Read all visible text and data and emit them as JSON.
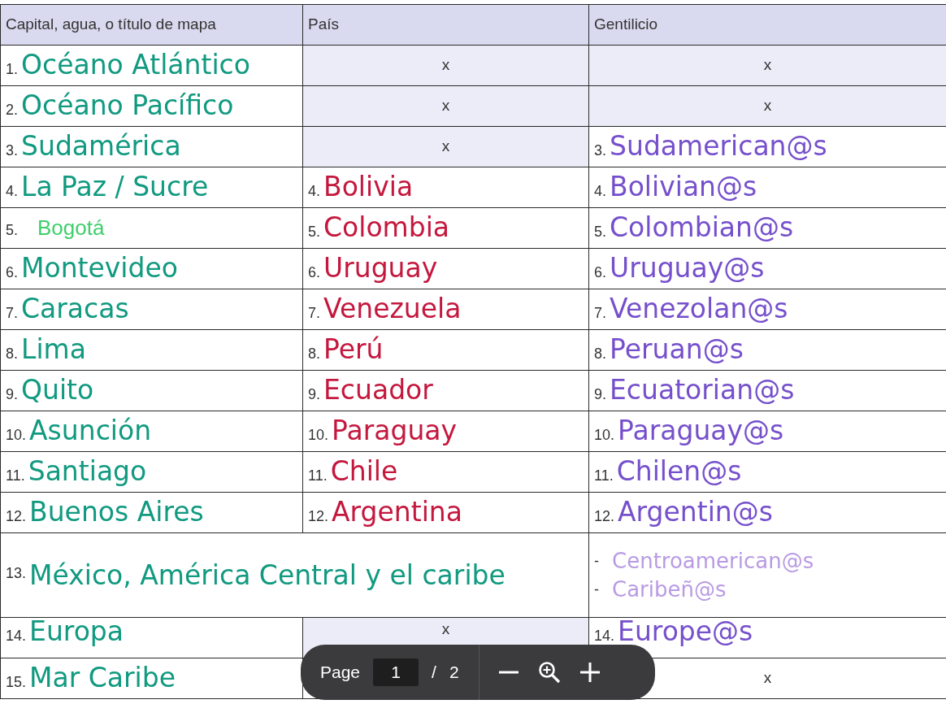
{
  "table": {
    "columns": [
      "Capital, agua, o título de mapa",
      "País",
      "Gentilicio"
    ],
    "rows": [
      {
        "cells": [
          {
            "kind": "handwritten",
            "number": "1.",
            "text": "Océano Atlántico",
            "shaded": false
          },
          {
            "kind": "mark",
            "text": "x",
            "shaded": true
          },
          {
            "kind": "mark",
            "text": "x",
            "shaded": true
          }
        ]
      },
      {
        "cells": [
          {
            "kind": "handwritten",
            "number": "2.",
            "text": "Océano Pacífico",
            "shaded": false
          },
          {
            "kind": "mark",
            "text": "x",
            "shaded": true
          },
          {
            "kind": "mark",
            "text": "x",
            "shaded": true
          }
        ]
      },
      {
        "cells": [
          {
            "kind": "handwritten",
            "number": "3.",
            "text": "Sudamérica",
            "shaded": false
          },
          {
            "kind": "mark",
            "text": "x",
            "shaded": true
          },
          {
            "kind": "handwritten",
            "number": "3.",
            "text": "Sudamerican@s",
            "shaded": false
          }
        ]
      },
      {
        "cells": [
          {
            "kind": "handwritten",
            "number": "4.",
            "text": "La Paz / Sucre",
            "shaded": false
          },
          {
            "kind": "handwritten",
            "number": "4.",
            "text": "Bolivia",
            "shaded": false
          },
          {
            "kind": "handwritten",
            "number": "4.",
            "text": "Bolivian@s",
            "shaded": false
          }
        ]
      },
      {
        "cells": [
          {
            "kind": "typed",
            "number": "5.",
            "text": "Bogotá",
            "shaded": false
          },
          {
            "kind": "handwritten",
            "number": "5.",
            "text": "Colombia",
            "shaded": false
          },
          {
            "kind": "handwritten",
            "number": "5.",
            "text": "Colombian@s",
            "shaded": false
          }
        ]
      },
      {
        "cells": [
          {
            "kind": "handwritten",
            "number": "6.",
            "text": "Montevideo",
            "shaded": false
          },
          {
            "kind": "handwritten",
            "number": "6.",
            "text": "Uruguay",
            "shaded": false
          },
          {
            "kind": "handwritten",
            "number": "6.",
            "text": "Uruguay@s",
            "shaded": false
          }
        ]
      },
      {
        "cells": [
          {
            "kind": "handwritten",
            "number": "7.",
            "text": "Caracas",
            "shaded": false
          },
          {
            "kind": "handwritten",
            "number": "7.",
            "text": "Venezuela",
            "shaded": false
          },
          {
            "kind": "handwritten",
            "number": "7.",
            "text": "Venezolan@s",
            "shaded": false
          }
        ]
      },
      {
        "cells": [
          {
            "kind": "handwritten",
            "number": "8.",
            "text": "Lima",
            "shaded": false
          },
          {
            "kind": "handwritten",
            "number": "8.",
            "text": "Perú",
            "shaded": false
          },
          {
            "kind": "handwritten",
            "number": "8.",
            "text": "Peruan@s",
            "shaded": false
          }
        ]
      },
      {
        "cells": [
          {
            "kind": "handwritten",
            "number": "9.",
            "text": "Quito",
            "shaded": false
          },
          {
            "kind": "handwritten",
            "number": "9.",
            "text": "Ecuador",
            "shaded": false
          },
          {
            "kind": "handwritten",
            "number": "9.",
            "text": "Ecuatorian@s",
            "shaded": false
          }
        ]
      },
      {
        "cells": [
          {
            "kind": "handwritten",
            "number": "10.",
            "text": "Asunción",
            "shaded": false
          },
          {
            "kind": "handwritten",
            "number": "10.",
            "text": "Paraguay",
            "shaded": false
          },
          {
            "kind": "handwritten",
            "number": "10.",
            "text": "Paraguay@s",
            "shaded": false
          }
        ]
      },
      {
        "cells": [
          {
            "kind": "handwritten",
            "number": "11.",
            "text": "Santiago",
            "shaded": false
          },
          {
            "kind": "handwritten",
            "number": "11.",
            "text": "Chile",
            "shaded": false
          },
          {
            "kind": "handwritten",
            "number": "11.",
            "text": "Chilen@s",
            "shaded": false
          }
        ]
      },
      {
        "cells": [
          {
            "kind": "handwritten",
            "number": "12.",
            "text": "Buenos Aires",
            "shaded": false
          },
          {
            "kind": "handwritten",
            "number": "12.",
            "text": "Argentina",
            "shaded": false
          },
          {
            "kind": "handwritten",
            "number": "12.",
            "text": "Argentin@s",
            "shaded": false
          }
        ]
      },
      {
        "cells": [
          {
            "kind": "wide",
            "colspan": 2,
            "number": "13.",
            "text": "México, América Central y el caribe",
            "shaded": false
          },
          {
            "kind": "list",
            "items": [
              {
                "number": "-",
                "text": "Centroamerican@s"
              },
              {
                "number": "-",
                "text": "Caribeñ@s"
              }
            ],
            "shaded": false
          }
        ]
      },
      {
        "cells": [
          {
            "kind": "handwritten",
            "number": "14.",
            "text": "Europa",
            "shaded": false
          },
          {
            "kind": "mark",
            "text": "x",
            "shaded": true
          },
          {
            "kind": "handwritten",
            "number": "14.",
            "text": "Europe@s",
            "shaded": false
          }
        ]
      },
      {
        "cells": [
          {
            "kind": "handwritten",
            "number": "15.",
            "text": "Mar Caribe",
            "shaded": false
          },
          {
            "kind": "mark",
            "shaded": false
          },
          {
            "kind": "mark",
            "text": "x",
            "shaded": false
          }
        ]
      }
    ]
  },
  "toolbar": {
    "page_label": "Page",
    "current_page": "1",
    "separator": "/",
    "total_pages": "2"
  }
}
